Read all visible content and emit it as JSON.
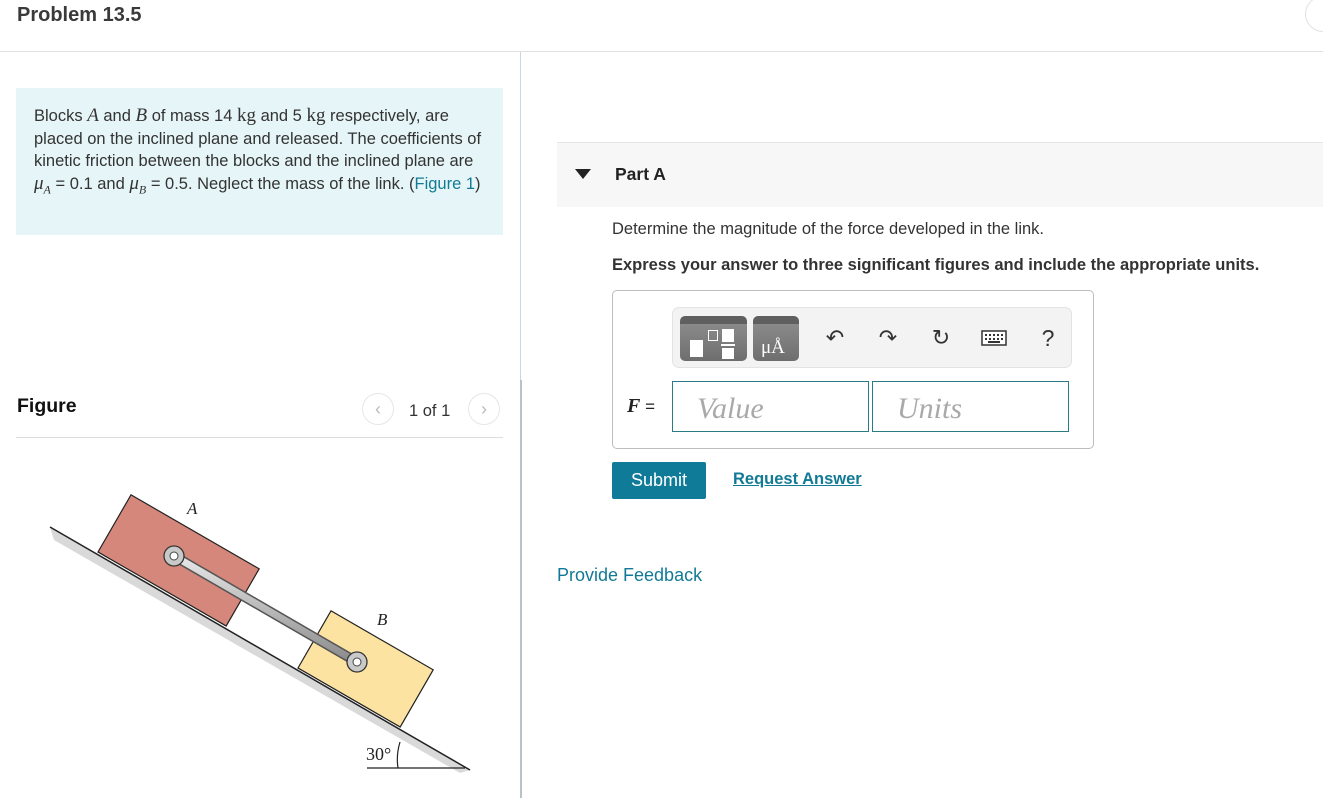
{
  "header": {
    "title": "Problem 13.5"
  },
  "intro": {
    "t1": "Blocks ",
    "blockA": "A",
    "t2": " and ",
    "blockB": "B",
    "t3": " of mass 14 ",
    "unit1": "kg",
    "t4": " and 5 ",
    "unit2": "kg",
    "t5": " respectively, are placed on the inclined plane and released. The coefficients of kinetic friction between the blocks and the inclined plane are ",
    "mu": "μ",
    "subA": "A",
    "t6": " = 0.1 and ",
    "subB": "B",
    "t7": " = 0.5. Neglect the mass of the link. (",
    "figure_link": "Figure 1",
    "t8": ")"
  },
  "figure_panel": {
    "label": "Figure",
    "pager": "1 of 1",
    "prev_icon": "‹",
    "next_icon": "›",
    "diagram": {
      "label_a": "A",
      "label_b": "B",
      "angle": "30°"
    }
  },
  "part": {
    "label": "Part A",
    "question": "Determine the magnitude of the force developed in the link.",
    "instruction": "Express your answer to three significant figures and include the appropriate units.",
    "toolbar": {
      "units_glyph": "μÅ",
      "undo": "↶",
      "redo": "↷",
      "reset": "↻",
      "help": "?"
    },
    "variable": "F",
    "equals": " =",
    "value_placeholder": "Value",
    "units_placeholder": "Units",
    "submit_label": "Submit",
    "request_label": "Request Answer"
  },
  "feedback_label": "Provide Feedback",
  "colors": {
    "accent": "#0f7b99",
    "link": "#127a96",
    "intro_bg": "#e6f5f7",
    "block_a": "#d4877a",
    "block_b": "#fde3a2"
  }
}
